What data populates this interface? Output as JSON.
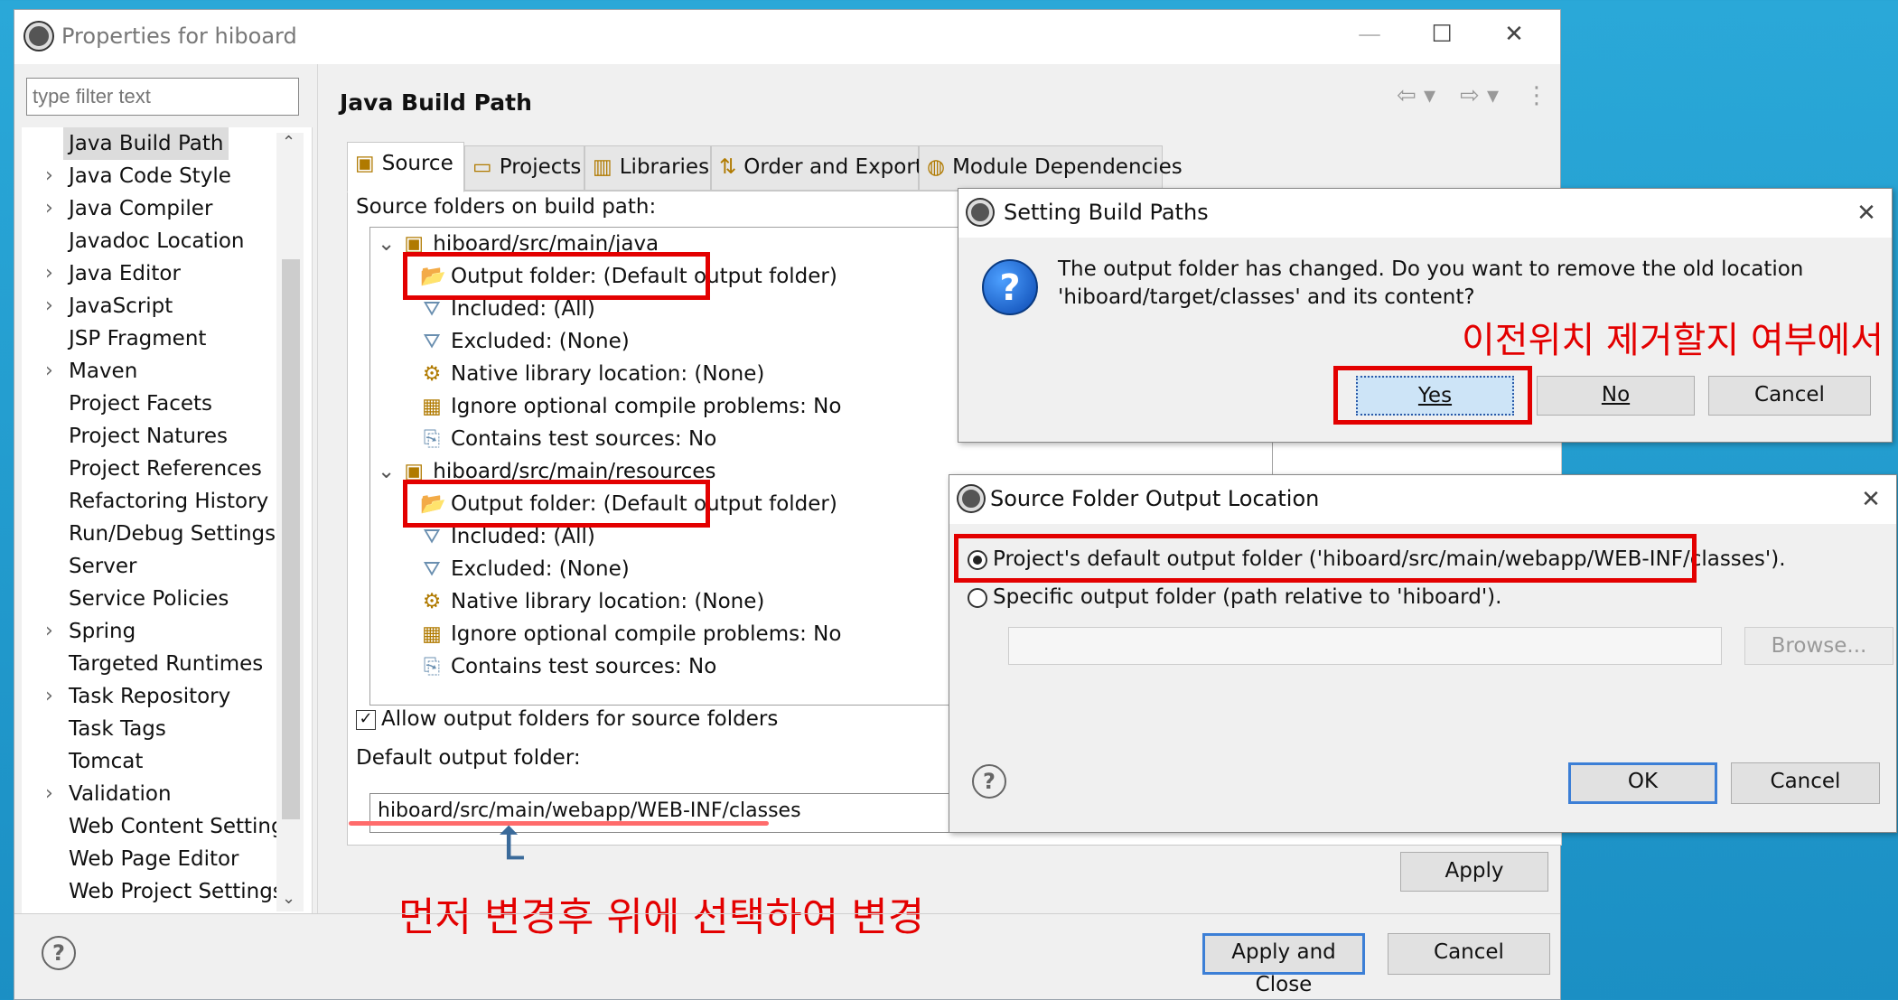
{
  "window": {
    "title": "Properties for hiboard",
    "minimize": "—",
    "maximize": "☐",
    "close": "✕"
  },
  "filter": {
    "placeholder": "type filter text"
  },
  "tree": {
    "items": [
      {
        "label": "Java Build Path",
        "arrow": ""
      },
      {
        "label": "Java Code Style",
        "arrow": "›"
      },
      {
        "label": "Java Compiler",
        "arrow": "›"
      },
      {
        "label": "Javadoc Location",
        "arrow": ""
      },
      {
        "label": "Java Editor",
        "arrow": "›"
      },
      {
        "label": "JavaScript",
        "arrow": "›"
      },
      {
        "label": "JSP Fragment",
        "arrow": ""
      },
      {
        "label": "Maven",
        "arrow": "›"
      },
      {
        "label": "Project Facets",
        "arrow": ""
      },
      {
        "label": "Project Natures",
        "arrow": ""
      },
      {
        "label": "Project References",
        "arrow": ""
      },
      {
        "label": "Refactoring History",
        "arrow": ""
      },
      {
        "label": "Run/Debug Settings",
        "arrow": ""
      },
      {
        "label": "Server",
        "arrow": ""
      },
      {
        "label": "Service Policies",
        "arrow": ""
      },
      {
        "label": "Spring",
        "arrow": "›"
      },
      {
        "label": "Targeted Runtimes",
        "arrow": ""
      },
      {
        "label": "Task Repository",
        "arrow": "›"
      },
      {
        "label": "Task Tags",
        "arrow": ""
      },
      {
        "label": "Tomcat",
        "arrow": ""
      },
      {
        "label": "Validation",
        "arrow": "›"
      },
      {
        "label": "Web Content Settings",
        "arrow": ""
      },
      {
        "label": "Web Page Editor",
        "arrow": ""
      },
      {
        "label": "Web Project Settings",
        "arrow": ""
      }
    ]
  },
  "header": {
    "title": "Java Build Path"
  },
  "tabs": [
    {
      "label": "Source",
      "icon": "source-icon"
    },
    {
      "label": "Projects",
      "icon": "projects-icon"
    },
    {
      "label": "Libraries",
      "icon": "libraries-icon"
    },
    {
      "label": "Order and Export",
      "icon": "order-icon"
    },
    {
      "label": "Module Dependencies",
      "icon": "module-icon"
    }
  ],
  "source": {
    "list_label": "Source folders on build path:",
    "folders": [
      {
        "path": "hiboard/src/main/java",
        "children": [
          "Output folder: (Default output folder)",
          "Included: (All)",
          "Excluded: (None)",
          "Native library location: (None)",
          "Ignore optional compile problems: No",
          "Contains test sources: No"
        ]
      },
      {
        "path": "hiboard/src/main/resources",
        "children": [
          "Output folder: (Default output folder)",
          "Included: (All)",
          "Excluded: (None)",
          "Native library location: (None)",
          "Ignore optional compile problems: No",
          "Contains test sources: No"
        ]
      }
    ],
    "allow_output_label": "Allow output folders for source folders",
    "allow_output_checked": "✓",
    "default_output_label": "Default output folder:",
    "default_output_value": "hiboard/src/main/webapp/WEB-INF/classes"
  },
  "buttons": {
    "apply": "Apply",
    "apply_close": "Apply and Close",
    "cancel": "Cancel",
    "help": "?"
  },
  "annotations": {
    "bottom": "먼저 변경후 위에 선택하여 변경",
    "top": "이전위치 제거할지 여부에서",
    "arrow": "⮤"
  },
  "setting_dialog": {
    "title": "Setting Build Paths",
    "message_line1": "The output folder has changed. Do you want to remove the old location",
    "message_line2": "'hiboard/target/classes' and its content?",
    "yes": "Yes",
    "no": "No",
    "cancel": "Cancel",
    "close": "✕"
  },
  "output_dialog": {
    "title": "Source Folder Output Location",
    "option_default": "Project's default output folder ('hiboard/src/main/webapp/WEB-INF/classes').",
    "option_specific": "Specific output folder (path relative to 'hiboard').",
    "browse": "Browse...",
    "ok": "OK",
    "cancel": "Cancel",
    "close": "✕",
    "help": "?"
  }
}
